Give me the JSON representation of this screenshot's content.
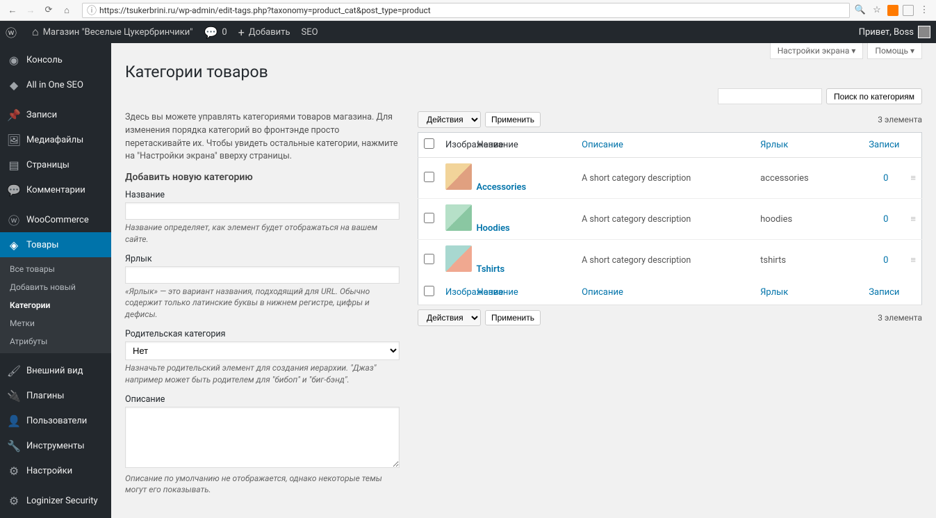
{
  "browser": {
    "url": "https://tsukerbrini.ru/wp-admin/edit-tags.php?taxonomy=product_cat&post_type=product"
  },
  "adminbar": {
    "site_name": "Магазин \"Веселые Цукербринчики\"",
    "comments": "0",
    "add_new": "Добавить",
    "seo": "SEO",
    "greeting": "Привет, Boss"
  },
  "menu": {
    "console": "Консоль",
    "aioseo": "All in One SEO",
    "posts": "Записи",
    "media": "Медиафайлы",
    "pages": "Страницы",
    "comments": "Комментарии",
    "woocommerce": "WooCommerce",
    "products": "Товары",
    "sub_all": "Все товары",
    "sub_add": "Добавить новый",
    "sub_categories": "Категории",
    "sub_tags": "Метки",
    "sub_attrs": "Атрибуты",
    "appearance": "Внешний вид",
    "plugins": "Плагины",
    "users": "Пользователи",
    "tools": "Инструменты",
    "settings": "Настройки",
    "loginizer": "Loginizer Security"
  },
  "screen_meta": {
    "options": "Настройки экрана",
    "help": "Помощь"
  },
  "page": {
    "title": "Категории товаров",
    "intro": "Здесь вы можете управлять категориями товаров магазина. Для изменения порядка категорий во фронтэнде просто перетаскивайте их. Чтобы увидеть остальные категории, нажмите на \"Настройки экрана\" вверху страницы.",
    "add_heading": "Добавить новую категорию"
  },
  "form": {
    "name_label": "Название",
    "name_desc": "Название определяет, как элемент будет отображаться на вашем сайте.",
    "slug_label": "Ярлык",
    "slug_desc": "«Ярлык» — это вариант названия, подходящий для URL. Обычно содержит только латинские буквы в нижнем регистре, цифры и дефисы.",
    "parent_label": "Родительская категория",
    "parent_option": "Нет",
    "parent_desc": "Назначьте родительский элемент для создания иерархии. \"Джаз\" например может быть родителем для \"бибоп\" и \"биг-бэнд\".",
    "desc_label": "Описание",
    "desc_desc": "Описание по умолчанию не отображается, однако некоторые темы могут его показывать."
  },
  "search": {
    "button": "Поиск по категориям"
  },
  "bulk": {
    "actions": "Действия",
    "apply": "Применить",
    "count": "3 элемента"
  },
  "table": {
    "col_image": "Изображение",
    "col_name": "Название",
    "col_desc": "Описание",
    "col_slug": "Ярлык",
    "col_posts": "Записи",
    "rows": [
      {
        "name": "Accessories",
        "desc": "A short category description",
        "slug": "accessories",
        "count": "0"
      },
      {
        "name": "Hoodies",
        "desc": "A short category description",
        "slug": "hoodies",
        "count": "0"
      },
      {
        "name": "Tshirts",
        "desc": "A short category description",
        "slug": "tshirts",
        "count": "0"
      }
    ]
  }
}
